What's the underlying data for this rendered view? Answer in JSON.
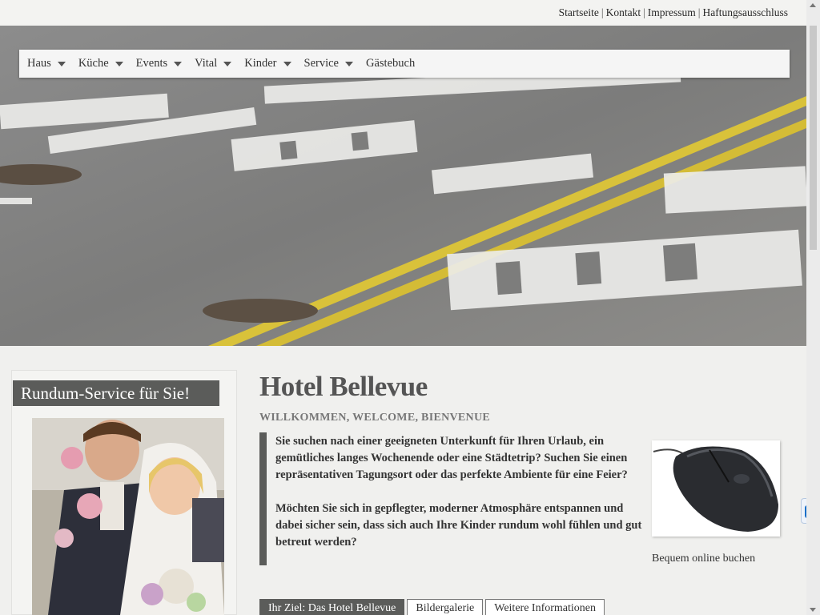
{
  "top_links": [
    "Startseite",
    "Kontakt",
    "Impressum",
    "Haftungsausschluss"
  ],
  "nav": {
    "items": [
      {
        "label": "Haus",
        "has_dropdown": true
      },
      {
        "label": "Küche",
        "has_dropdown": true
      },
      {
        "label": "Events",
        "has_dropdown": true
      },
      {
        "label": "Vital",
        "has_dropdown": true
      },
      {
        "label": "Kinder",
        "has_dropdown": true
      },
      {
        "label": "Service",
        "has_dropdown": true
      },
      {
        "label": "Gästebuch",
        "has_dropdown": false
      }
    ]
  },
  "hero": {
    "icon": "street-photo"
  },
  "sidebar": {
    "title": "Rundum-Service für Sie!",
    "image": "wedding-photo"
  },
  "main": {
    "title": "Hotel Bellevue",
    "subtitle": "WILLKOMMEN, WELCOME, BIENVENUE",
    "paragraph1": "Sie suchen nach einer geeigneten Unterkunft für Ihren Urlaub, ein gemütliches langes Wochenende oder eine Städtetrip? Suchen Sie einen repräsentativen Tagungsort oder das perfekte Ambiente für eine Feier?",
    "paragraph2": "Möchten Sie sich in gepflegter, moderner Atmosphäre entspannen und dabei sicher sein, dass sich auch Ihre Kinder rundum wohl fühlen und gut betreut werden?"
  },
  "booking": {
    "caption": "Bequem online buchen",
    "image": "computer-mouse-photo"
  },
  "tabs": [
    {
      "label": "Ihr Ziel: Das Hotel Bellevue",
      "active": true
    },
    {
      "label": "Bildergalerie",
      "active": false
    },
    {
      "label": "Weitere Informationen",
      "active": false
    }
  ],
  "colors": {
    "accent": "#5b5c5a",
    "background": "#f0f0ee"
  }
}
